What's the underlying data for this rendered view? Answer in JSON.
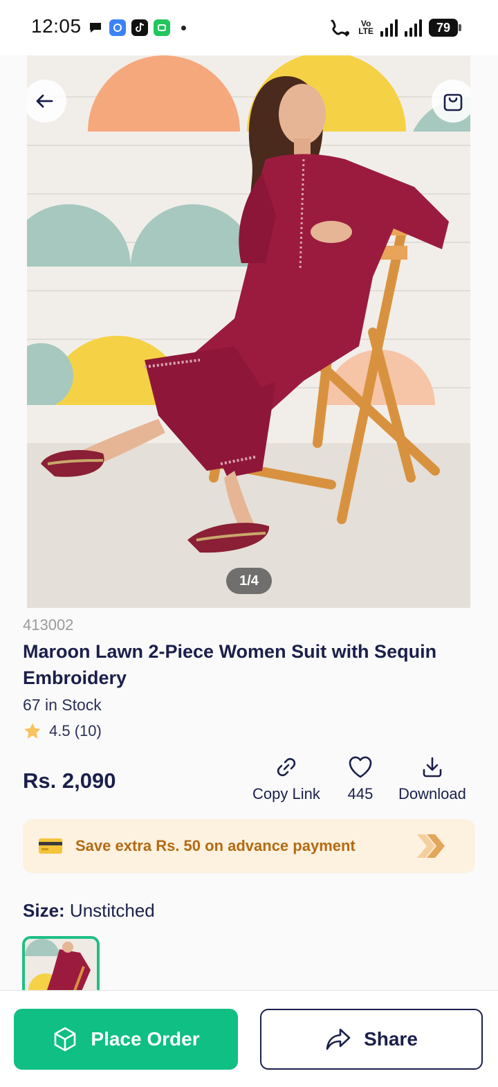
{
  "status_bar": {
    "time": "12:05",
    "battery": "79",
    "volte_top": "Vo",
    "volte_bottom": "LTE"
  },
  "product": {
    "image_counter": "1/4",
    "sku": "413002",
    "title": "Maroon Lawn 2-Piece Women Suit with Sequin Embroidery",
    "stock": "67 in Stock",
    "rating": "4.5 (10)",
    "price": "Rs. 2,090"
  },
  "actions": {
    "copy_link": "Copy Link",
    "likes": "445",
    "download": "Download"
  },
  "promo": {
    "text": "Save extra Rs. 50 on advance payment"
  },
  "size": {
    "label": "Size:",
    "value": "Unstitched"
  },
  "bottom_bar": {
    "order_label": "Place Order",
    "share_label": "Share"
  },
  "colors": {
    "primary_green": "#0fbf84",
    "navy": "#1a1f4a",
    "promo_bg": "#fdf1e0",
    "promo_text": "#b36b12",
    "dress_maroon": "#9b1b3f"
  }
}
